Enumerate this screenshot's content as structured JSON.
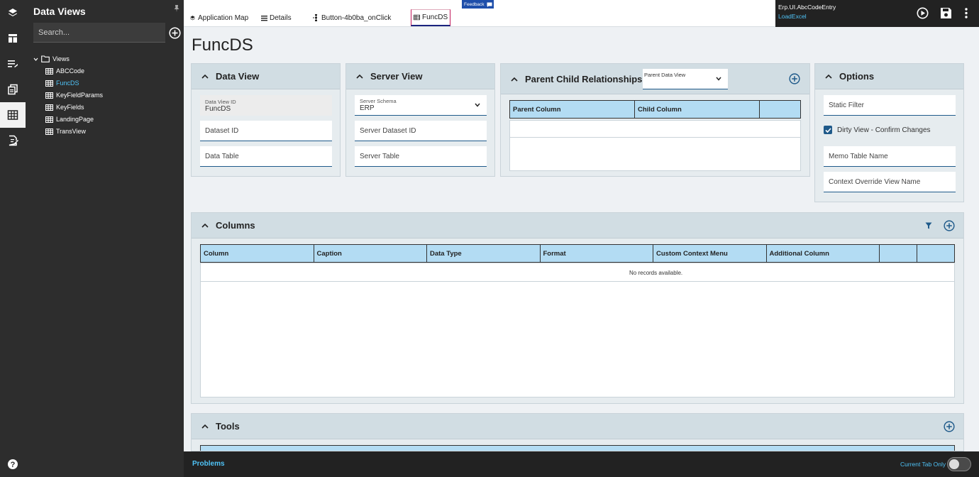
{
  "rail": {
    "icons": [
      "layers-icon",
      "layout-icon",
      "list-edit-icon",
      "copy-icon",
      "table-icon",
      "edit-doc-icon",
      "help-icon"
    ]
  },
  "navigator": {
    "title": "Data Views",
    "search_placeholder": "Search...",
    "tree": {
      "folder": "Views",
      "items": [
        {
          "label": "ABCCode",
          "selected": false
        },
        {
          "label": "FuncDS",
          "selected": true
        },
        {
          "label": "KeyFieldParams",
          "selected": false
        },
        {
          "label": "KeyFields",
          "selected": false
        },
        {
          "label": "LandingPage",
          "selected": false
        },
        {
          "label": "TransView",
          "selected": false
        }
      ]
    }
  },
  "tabs": [
    {
      "label": "Application Map",
      "icon": "layers-icon"
    },
    {
      "label": "Details",
      "icon": "list-icon"
    },
    {
      "label": "Button-4b0ba_onClick",
      "icon": "flow-icon"
    },
    {
      "label": "FuncDS",
      "icon": "table-icon",
      "active": true
    }
  ],
  "feedback": "Feedback",
  "toolbar": {
    "app_name": "Erp.UI.AbcCodeEntry",
    "layer": "LoadExcel",
    "icons": [
      "run-icon",
      "save-icon",
      "more-vert-icon"
    ]
  },
  "page": {
    "title": "FuncDS"
  },
  "data_view": {
    "header": "Data View",
    "id_label": "Data View ID",
    "id_value": "FuncDS",
    "dataset_id_placeholder": "Dataset ID",
    "data_table_placeholder": "Data Table"
  },
  "server_view": {
    "header": "Server View",
    "schema_label": "Server Schema",
    "schema_value": "ERP",
    "dataset_id_placeholder": "Server Dataset ID",
    "table_placeholder": "Server Table"
  },
  "parent_child": {
    "header": "Parent Child Relationships",
    "parent_dropdown_label": "Parent Data View",
    "columns": [
      "Parent Column",
      "Child Column",
      ""
    ]
  },
  "options": {
    "header": "Options",
    "static_filter_placeholder": "Static Filter",
    "dirty_view_label": "Dirty View - Confirm Changes",
    "dirty_view_checked": true,
    "memo_table_placeholder": "Memo Table Name",
    "context_override_placeholder": "Context Override View Name"
  },
  "columns_panel": {
    "header": "Columns",
    "columns": [
      "Column",
      "Caption",
      "Data Type",
      "Format",
      "Custom Context Menu",
      "Additional Column",
      "",
      ""
    ],
    "empty_text": "No records available."
  },
  "tools_panel": {
    "header": "Tools"
  },
  "bottom": {
    "problems": "Problems",
    "current_tab_only": "Current Tab Only",
    "toggle_on": false
  }
}
